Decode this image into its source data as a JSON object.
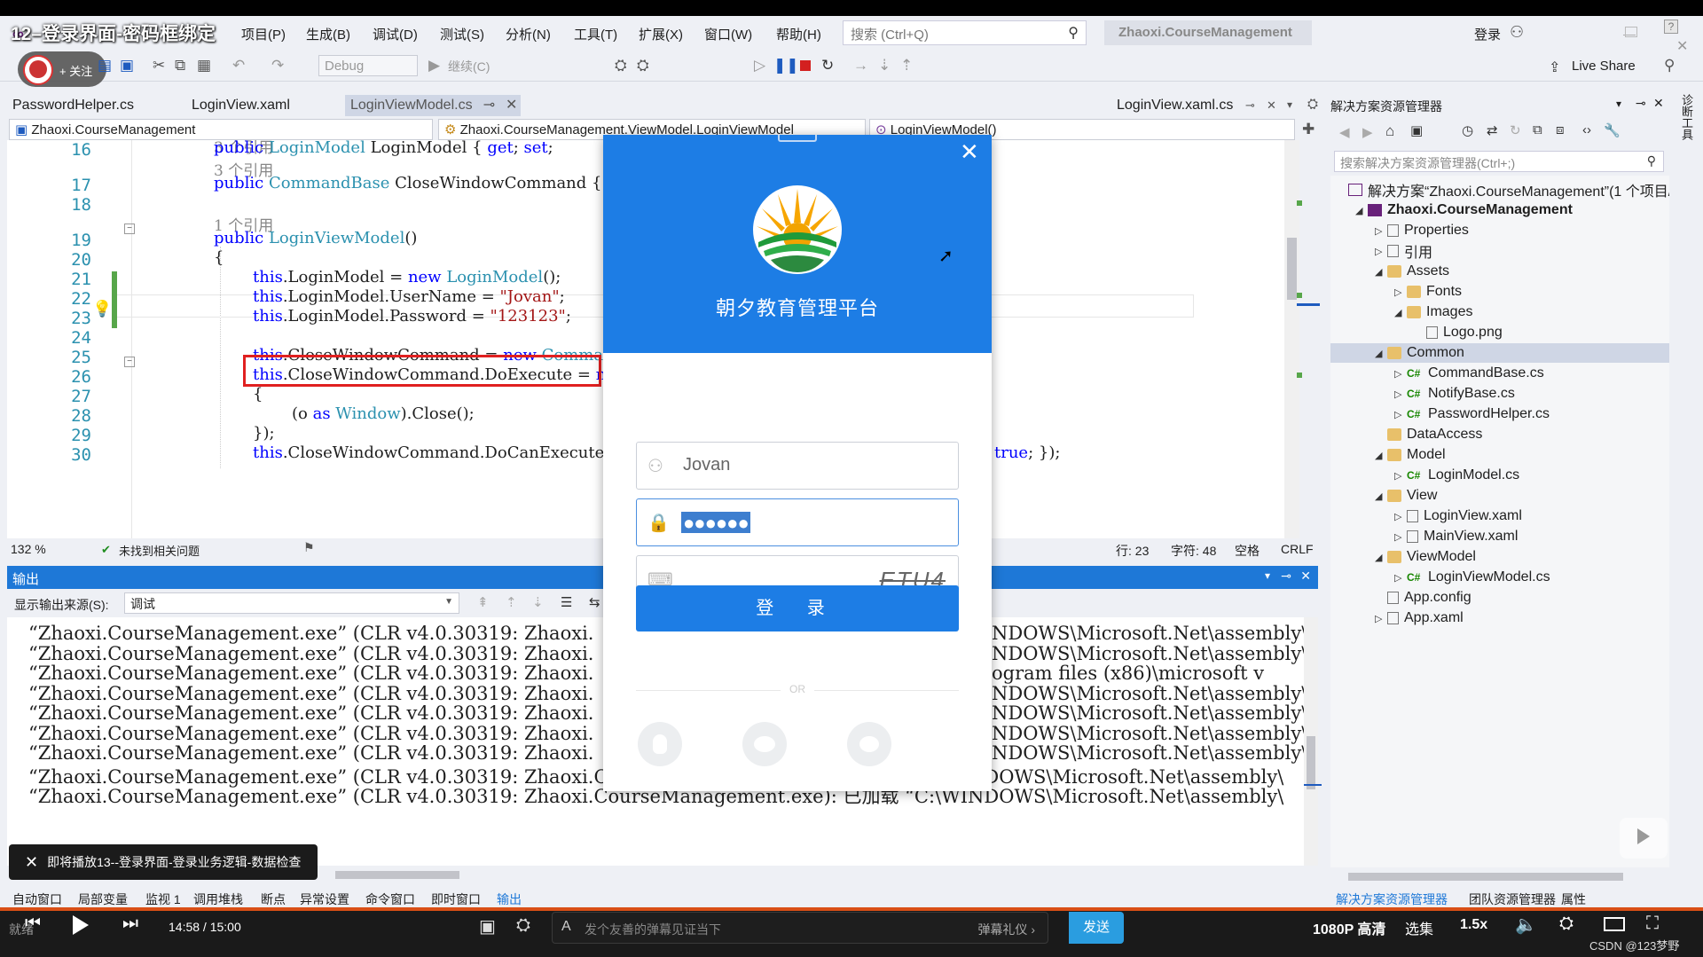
{
  "video": {
    "title": "12–登录界面-密码框绑定"
  },
  "menu": {
    "items": [
      "项目(P)",
      "生成(B)",
      "调试(D)",
      "测试(S)",
      "分析(N)",
      "工具(T)",
      "扩展(X)",
      "窗口(W)",
      "帮助(H)"
    ]
  },
  "search": {
    "placeholder": "搜索 (Ctrl+Q)"
  },
  "solution_name": "Zhaoxi.CourseManagement",
  "account": {
    "login": "登录"
  },
  "toolbar": {
    "config": "Debug",
    "start": "继续(C)",
    "live_share": "Live Share"
  },
  "follow": {
    "label": "+ 关注"
  },
  "tabs": {
    "left": [
      "PasswordHelper.cs",
      "LoginView.xaml",
      "LoginViewModel.cs"
    ],
    "right": "LoginView.xaml.cs"
  },
  "nav": {
    "project": "Zhaoxi.CourseManagement",
    "class": "Zhaoxi.CourseManagement.ViewModel.LoginViewModel",
    "member": "LoginViewModel()"
  },
  "code": {
    "ref3": "3 个引用",
    "ref1": "1 个引用",
    "lines": [
      "16",
      "17",
      "18",
      "19",
      "20",
      "21",
      "22",
      "23",
      "24",
      "25",
      "26",
      "27",
      "28",
      "29",
      "30"
    ],
    "l16a": "public ",
    "l16b": "LoginModel",
    "l16c": " LoginModel { ",
    "l16d": "get",
    "l16e": "; ",
    "l16f": "set",
    "l16g": ";",
    "l17a": "public ",
    "l17b": "CommandBase",
    "l17c": " CloseWindowCommand { ",
    "l17d": "g",
    "l19a": "public ",
    "l19b": "LoginViewModel",
    "l19c": "()",
    "l20": "{",
    "this": "this",
    "new": "new",
    "l21a": ".LoginModel = ",
    "l21b": "LoginModel",
    "l21c": "();",
    "l22a": ".LoginModel.UserName = ",
    "l22b": "\"Jovan\"",
    "l22c": ";",
    "l23a": ".LoginModel.Password = ",
    "l23b": "\"123123\"",
    "l23c": ";",
    "l25a": ".CloseWindowCommand = ",
    "l25b": "Command",
    "l26a": ".CloseWindowCommand.DoExecute = ",
    "l26b": "n",
    "l27": "{",
    "l28a": "(o ",
    "l28b": "as",
    "l28c": " ",
    "l28d": "Window",
    "l28e": ").Close();",
    "l29": "});",
    "l30": ".CloseWindowCommand.DoCanExecute",
    "tail_true": "true",
    "tail_end": "; });"
  },
  "editor_status": {
    "zoom": "132 %",
    "issues": "未找到相关问题",
    "line": "行: 23",
    "col": "字符: 48",
    "ws": "空格",
    "eol": "CRLF"
  },
  "output": {
    "title": "输出",
    "source_label": "显示输出来源(S):",
    "source_value": "调试",
    "left_text": "“Zhaoxi.CourseManagement.exe” (CLR v4.0.30319: Zhaoxi.",
    "full_tail": "CourseManagement.exe): 已加载 “C:\\WINDOWS\\Microsoft.Net\\assembly\\",
    "right_tails": [
      "NDOWS\\Microsoft.Net\\assembly\\",
      "NDOWS\\Microsoft.Net\\assembly\\",
      "ogram files (x86)\\microsoft v",
      "NDOWS\\Microsoft.Net\\assembly\\",
      "NDOWS\\Microsoft.Net\\assembly\\",
      "NDOWS\\Microsoft.Net\\assembly\\",
      "NDOWS\\Microsoft.Net\\assembly\\"
    ]
  },
  "bottom_tabs": [
    "自动窗口",
    "局部变量",
    "监视 1",
    "调用堆栈",
    "断点",
    "异常设置",
    "命令窗口",
    "即时窗口",
    "输出"
  ],
  "bottom_tabs_right": [
    "解决方案资源管理器",
    "团队资源管理器",
    "属性"
  ],
  "solution_explorer": {
    "title": "解决方案资源管理器",
    "search": "搜索解决方案资源管理器(Ctrl+;)",
    "items": [
      {
        "label": "解决方案“Zhaoxi.CourseManagement”(1 个项目/",
        "depth": 0,
        "kind": "solution",
        "arrow": ""
      },
      {
        "label": "Zhaoxi.CourseManagement",
        "depth": 1,
        "kind": "project",
        "arrow": "◢"
      },
      {
        "label": "Properties",
        "depth": 2,
        "kind": "props",
        "arrow": "▷"
      },
      {
        "label": "引用",
        "depth": 2,
        "kind": "refs",
        "arrow": "▷"
      },
      {
        "label": "Assets",
        "depth": 2,
        "kind": "folder",
        "arrow": "◢"
      },
      {
        "label": "Fonts",
        "depth": 3,
        "kind": "folder",
        "arrow": "▷"
      },
      {
        "label": "Images",
        "depth": 3,
        "kind": "folder",
        "arrow": "◢"
      },
      {
        "label": "Logo.png",
        "depth": 4,
        "kind": "image",
        "arrow": ""
      },
      {
        "label": "Common",
        "depth": 2,
        "kind": "folder",
        "arrow": "◢"
      },
      {
        "label": "CommandBase.cs",
        "depth": 3,
        "kind": "cs",
        "arrow": "▷"
      },
      {
        "label": "NotifyBase.cs",
        "depth": 3,
        "kind": "cs",
        "arrow": "▷"
      },
      {
        "label": "PasswordHelper.cs",
        "depth": 3,
        "kind": "cs",
        "arrow": "▷"
      },
      {
        "label": "DataAccess",
        "depth": 2,
        "kind": "folder",
        "arrow": ""
      },
      {
        "label": "Model",
        "depth": 2,
        "kind": "folder",
        "arrow": "◢"
      },
      {
        "label": "LoginModel.cs",
        "depth": 3,
        "kind": "cs",
        "arrow": "▷"
      },
      {
        "label": "View",
        "depth": 2,
        "kind": "folder",
        "arrow": "◢"
      },
      {
        "label": "LoginView.xaml",
        "depth": 3,
        "kind": "xaml",
        "arrow": "▷"
      },
      {
        "label": "MainView.xaml",
        "depth": 3,
        "kind": "xaml",
        "arrow": "▷"
      },
      {
        "label": "ViewModel",
        "depth": 2,
        "kind": "folder",
        "arrow": "◢"
      },
      {
        "label": "LoginViewModel.cs",
        "depth": 3,
        "kind": "cs",
        "arrow": "▷"
      },
      {
        "label": "App.config",
        "depth": 2,
        "kind": "config",
        "arrow": ""
      },
      {
        "label": "App.xaml",
        "depth": 2,
        "kind": "xaml",
        "arrow": "▷"
      }
    ]
  },
  "right_rail_label": "诊断工具",
  "login": {
    "platform_title": "朝夕教育管理平台",
    "username": "Jovan",
    "password_mask": "●●●●●●",
    "captcha": "ETU4",
    "button": "登 录",
    "or": "OR"
  },
  "player": {
    "time": "14:58 / 15:00",
    "danmaku_placeholder": "发个友善的弹幕见证当下",
    "gift": "弹幕礼仪 ›",
    "send": "发送",
    "quality": "1080P 高清",
    "select": "选集",
    "speed": "1.5x",
    "up_next": "即将播放13--登录界面-登录业务逻辑-数据检查",
    "watermark": "CSDN @123梦野",
    "status": "就绪"
  },
  "colors": {
    "accent": "#1d7de5",
    "output_title": "#1e78d7",
    "highlight": "#e02020",
    "progress": "#d94f16"
  }
}
